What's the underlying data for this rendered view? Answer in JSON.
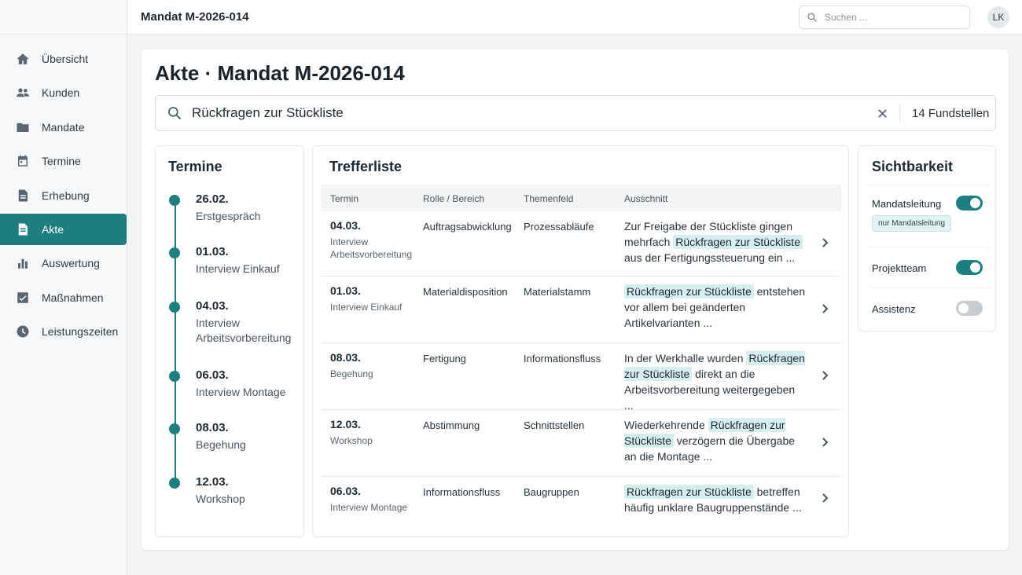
{
  "app": {
    "header_title": "Mandat M-2026-014",
    "avatar_initials": "LK"
  },
  "search": {
    "placeholder": "Suchen ..."
  },
  "sidebar": {
    "items": [
      {
        "label": "Übersicht",
        "icon": "home-icon",
        "active": false
      },
      {
        "label": "Kunden",
        "icon": "users-icon",
        "active": false
      },
      {
        "label": "Mandate",
        "icon": "folder-icon",
        "active": false
      },
      {
        "label": "Termine",
        "icon": "calendar-icon",
        "active": false
      },
      {
        "label": "Erhebung",
        "icon": "clipboard-icon",
        "active": false
      },
      {
        "label": "Akte",
        "icon": "document-icon",
        "active": true
      },
      {
        "label": "Auswertung",
        "icon": "bar-chart-icon",
        "active": false
      },
      {
        "label": "Maßnahmen",
        "icon": "checkbox-icon",
        "active": false
      },
      {
        "label": "Leistungszeiten",
        "icon": "clock-icon",
        "active": false
      }
    ]
  },
  "page": {
    "title": "Akte · Mandat M-2026-014",
    "query": "Rückfragen zur Stückliste",
    "results_count": "14 Fundstellen"
  },
  "termine": {
    "title": "Termine",
    "items": [
      {
        "date": "26.02.",
        "label": "Erstgespräch"
      },
      {
        "date": "01.03.",
        "label": "Interview Einkauf"
      },
      {
        "date": "04.03.",
        "label": "Interview Arbeitsvorbereitung"
      },
      {
        "date": "06.03.",
        "label": "Interview Montage"
      },
      {
        "date": "08.03.",
        "label": "Begehung"
      },
      {
        "date": "12.03.",
        "label": "Workshop"
      }
    ]
  },
  "trefferliste": {
    "title": "Trefferliste",
    "columns": [
      "Termin",
      "Rolle / Bereich",
      "Themenfeld",
      "Ausschnitt"
    ],
    "rows": [
      {
        "date": "04.03.",
        "termin": "Interview Arbeitsvorbereitung",
        "role": "Auftragsabwicklung",
        "theme": "Prozessabläufe",
        "pre": "Zur Freigabe der Stückliste gingen mehrfach ",
        "hit": "Rückfragen zur Stückliste",
        "post": " aus der Fertigungssteuerung ein ..."
      },
      {
        "date": "01.03.",
        "termin": "Interview Einkauf",
        "role": "Materialdisposition",
        "theme": "Materialstamm",
        "pre": "",
        "hit": "Rückfragen zur Stückliste",
        "post": " entstehen vor allem bei geänderten Artikelvarianten ..."
      },
      {
        "date": "08.03.",
        "termin": "Begehung",
        "role": "Fertigung",
        "theme": "Informationsfluss",
        "pre": "In der Werkhalle wurden ",
        "hit": "Rückfragen zur Stückliste",
        "post": " direkt an die Arbeitsvorbereitung weitergegeben ..."
      },
      {
        "date": "12.03.",
        "termin": "Workshop",
        "role": "Abstimmung",
        "theme": "Schnittstellen",
        "pre": "Wiederkehrende ",
        "hit": "Rückfragen zur Stückliste",
        "post": " verzögern die Übergabe an die Montage ..."
      },
      {
        "date": "06.03.",
        "termin": "Interview Montage",
        "role": "Informationsfluss",
        "theme": "Baugruppen",
        "pre": "",
        "hit": "Rückfragen zur Stückliste",
        "post": " betreffen häufig unklare Baugruppenstände ..."
      }
    ]
  },
  "sichtbarkeit": {
    "title": "Sichtbarkeit",
    "toggles": [
      {
        "label": "Mandatsleitung",
        "on": true
      },
      {
        "label": "Projektteam",
        "on": true
      },
      {
        "label": "Assistenz",
        "on": false
      }
    ],
    "badge": "nur Mandatsleitung"
  },
  "colors": {
    "accent": "#1d7f7f",
    "highlight": "#d5eeee",
    "toggle_off": "#c7ccd1"
  }
}
